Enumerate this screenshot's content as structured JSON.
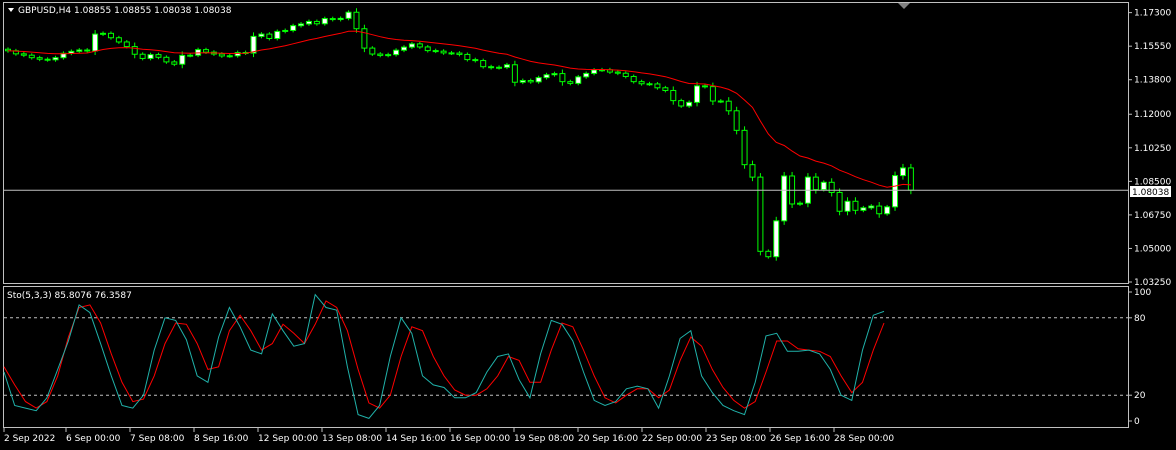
{
  "header": {
    "symbol_line": "GBPUSD,H4  1.08855 1.08855 1.08038 1.08038",
    "indicator_line": "Sto(5,3,3) 85.8076 76.3587"
  },
  "colors": {
    "background": "#000000",
    "frame": "#c0c0c0",
    "bull": "#00ff00",
    "bull_body": "#ffffff",
    "bear": "#00ff00",
    "bear_body": "#000000",
    "ma": "#ff0000",
    "stoch_main": "#20b2aa",
    "stoch_signal": "#ff0000",
    "price_line": "#c0c0c0",
    "level_line": "#c0c0c0"
  },
  "current_price": "1.08038",
  "chart_data": [
    {
      "type": "candlestick",
      "symbol": "GBPUSD",
      "timeframe": "H4",
      "ylim": [
        1.0325,
        1.1775
      ],
      "yticks": [
        "1.17300",
        "1.15550",
        "1.13800",
        "1.12000",
        "1.10250",
        "1.08500",
        "1.06750",
        "1.05000",
        "1.03250"
      ],
      "xticks": [
        "2 Sep 2022",
        "6 Sep 00:00",
        "7 Sep 08:00",
        "8 Sep 16:00",
        "12 Sep 00:00",
        "13 Sep 08:00",
        "14 Sep 16:00",
        "16 Sep 00:00",
        "19 Sep 08:00",
        "20 Sep 16:00",
        "22 Sep 00:00",
        "23 Sep 08:00",
        "26 Sep 16:00",
        "28 Sep 00:00"
      ],
      "close": [
        1.1531,
        1.1515,
        1.1508,
        1.1495,
        1.1487,
        1.1484,
        1.1495,
        1.1518,
        1.1528,
        1.1535,
        1.153,
        1.1618,
        1.1622,
        1.1599,
        1.1577,
        1.1553,
        1.1513,
        1.1491,
        1.1511,
        1.1497,
        1.1473,
        1.1461,
        1.1507,
        1.1508,
        1.1537,
        1.1524,
        1.1514,
        1.1504,
        1.1505,
        1.1522,
        1.1519,
        1.1606,
        1.1618,
        1.1595,
        1.1632,
        1.1637,
        1.1662,
        1.1671,
        1.1684,
        1.1672,
        1.1699,
        1.1694,
        1.17,
        1.1732,
        1.1646,
        1.1545,
        1.1514,
        1.1507,
        1.1511,
        1.1534,
        1.155,
        1.1567,
        1.1551,
        1.1532,
        1.1529,
        1.152,
        1.1519,
        1.1512,
        1.1485,
        1.148,
        1.1448,
        1.1443,
        1.1445,
        1.1458,
        1.1367,
        1.1376,
        1.1369,
        1.1391,
        1.1406,
        1.1412,
        1.137,
        1.1361,
        1.1395,
        1.1413,
        1.1431,
        1.1432,
        1.142,
        1.1414,
        1.1397,
        1.137,
        1.1359,
        1.1358,
        1.1338,
        1.1324,
        1.1271,
        1.1243,
        1.1262,
        1.1348,
        1.1344,
        1.1269,
        1.1268,
        1.1218,
        1.1116,
        1.0937,
        1.0872,
        1.0485,
        1.0457,
        1.0644,
        1.0878,
        1.0732,
        1.0736,
        1.0872,
        1.0807,
        1.0845,
        1.0792,
        1.0694,
        1.0746,
        1.0699,
        1.0712,
        1.0721,
        1.0681,
        1.0717,
        1.088,
        1.092,
        1.0804
      ],
      "ma_period_note": "",
      "stochastic": {
        "name": "Sto(5,3,3)",
        "main_last": 85.8076,
        "signal_last": 76.3587,
        "levels": [
          20,
          80
        ],
        "yticks": [
          "100",
          "80",
          "20",
          "0"
        ],
        "ylim": [
          0,
          100
        ],
        "main": [
          38,
          12,
          10,
          8,
          18,
          40,
          62,
          90,
          84,
          60,
          35,
          12,
          10,
          20,
          55,
          80,
          78,
          63,
          35,
          30,
          65,
          88,
          73,
          55,
          52,
          83,
          70,
          58,
          60,
          98,
          88,
          86,
          42,
          5,
          2,
          12,
          50,
          80,
          68,
          35,
          28,
          26,
          18,
          18,
          22,
          38,
          50,
          52,
          32,
          18,
          52,
          78,
          75,
          62,
          38,
          16,
          12,
          15,
          25,
          27,
          25,
          10,
          35,
          64,
          70,
          35,
          22,
          12,
          8,
          5,
          30,
          66,
          68,
          54,
          54,
          55,
          52,
          40,
          20,
          16,
          55,
          82,
          85
        ],
        "signal": [
          42,
          28,
          15,
          10,
          15,
          35,
          65,
          88,
          90,
          76,
          52,
          30,
          15,
          17,
          35,
          60,
          76,
          75,
          60,
          40,
          42,
          70,
          82,
          70,
          55,
          60,
          75,
          68,
          60,
          75,
          93,
          88,
          70,
          40,
          14,
          10,
          20,
          50,
          73,
          70,
          50,
          35,
          24,
          20,
          20,
          25,
          35,
          50,
          47,
          30,
          30,
          55,
          76,
          73,
          55,
          35,
          18,
          14,
          20,
          25,
          25,
          18,
          24,
          47,
          65,
          58,
          40,
          26,
          16,
          10,
          15,
          38,
          62,
          62,
          56,
          55,
          54,
          50,
          35,
          22,
          30,
          55,
          76
        ]
      }
    }
  ]
}
